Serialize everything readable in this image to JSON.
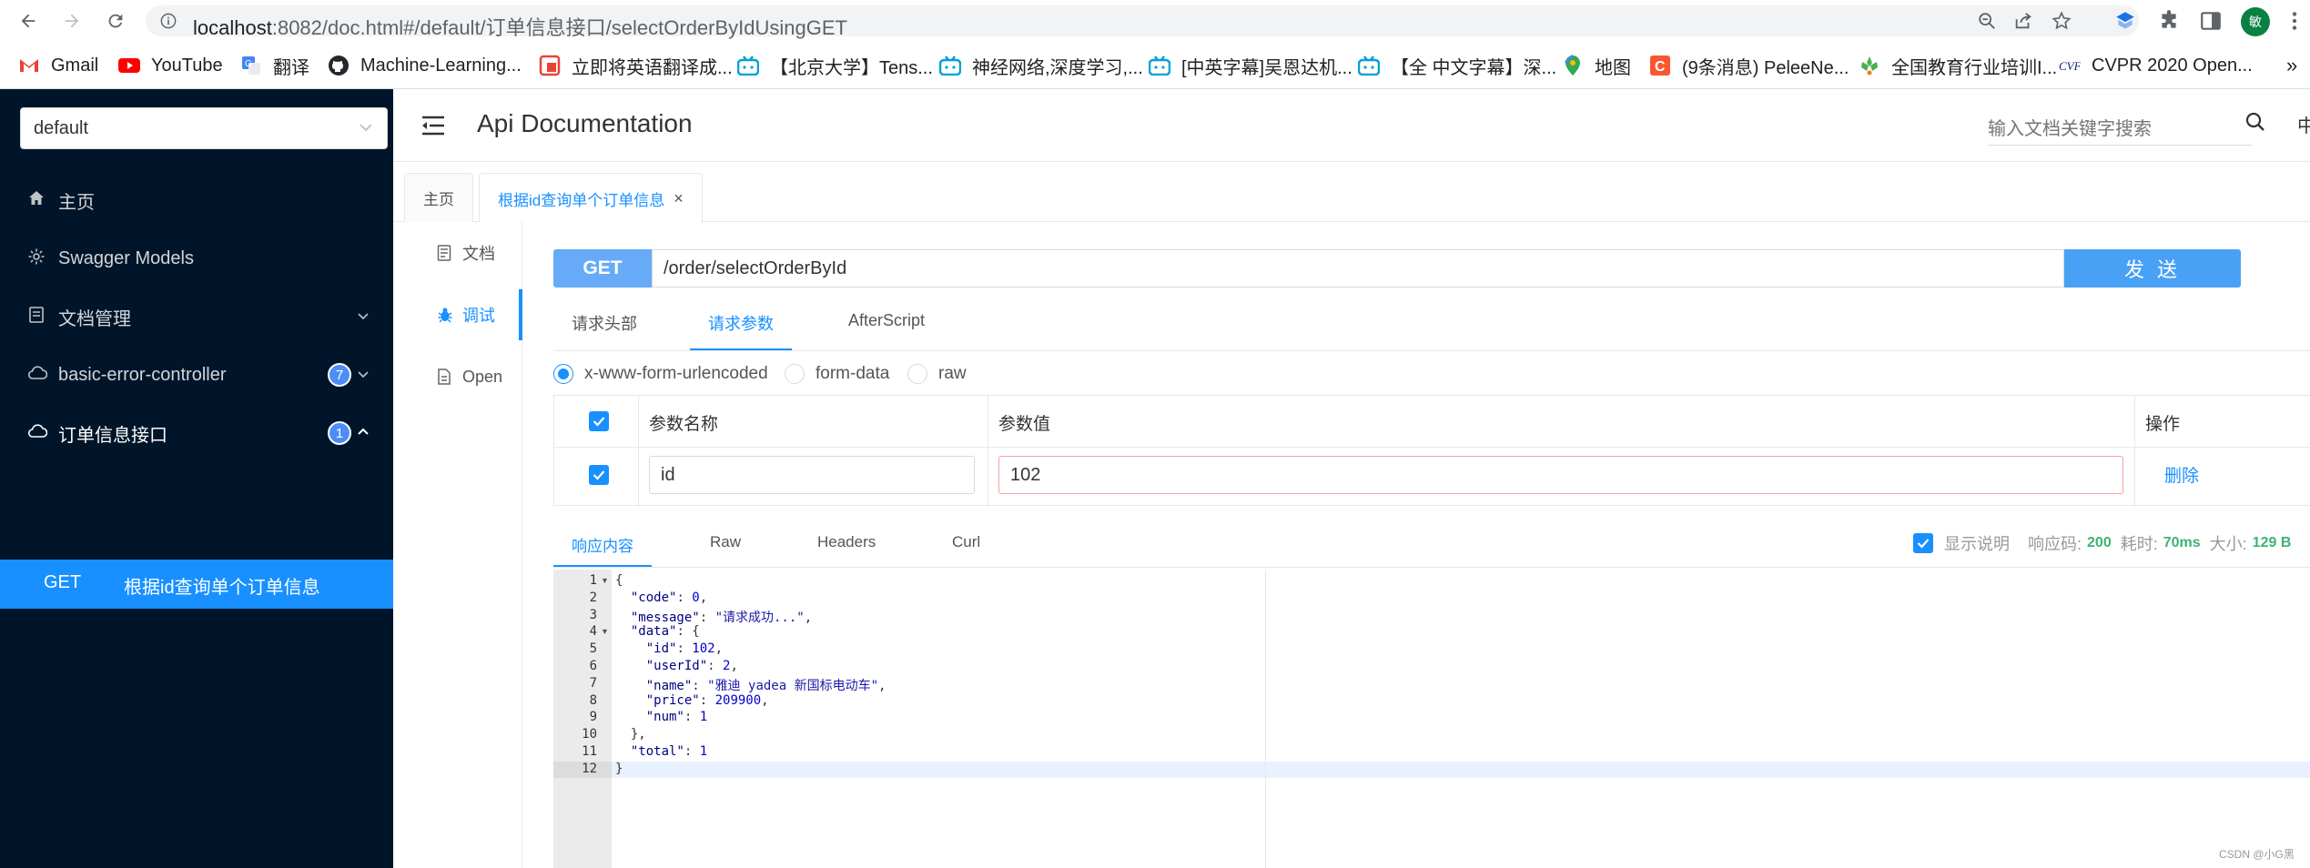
{
  "browser": {
    "url_host": "localhost",
    "url_rest": ":8082/doc.html#/default/订单信息接口/selectOrderByIdUsingGET",
    "profile_initial": "敏",
    "bookmarks": [
      {
        "label": "Gmail",
        "icon": "gmail-icon"
      },
      {
        "label": "YouTube",
        "icon": "youtube-icon"
      },
      {
        "label": "翻译",
        "icon": "translate-icon"
      },
      {
        "label": "Machine-Learning...",
        "icon": "github-icon"
      },
      {
        "label": "立即将英语翻译成...",
        "icon": "translate-app-icon"
      },
      {
        "label": "【北京大学】Tens...",
        "icon": "bilibili-icon"
      },
      {
        "label": "神经网络,深度学习,...",
        "icon": "bilibili-icon"
      },
      {
        "label": "[中英字幕]吴恩达机...",
        "icon": "bilibili-icon"
      },
      {
        "label": "【全 中文字幕】深...",
        "icon": "bilibili-icon"
      },
      {
        "label": "地图",
        "icon": "maps-icon"
      },
      {
        "label": "(9条消息) PeleeNe...",
        "icon": "csdn-icon"
      },
      {
        "label": "全国教育行业培训I...",
        "icon": "education-icon"
      },
      {
        "label": "CVPR 2020 Open...",
        "icon": "cvf-icon"
      }
    ],
    "bookmarks_overflow": "»"
  },
  "sidebar": {
    "group_select": "default",
    "items": [
      {
        "label": "主页",
        "icon": "home-icon"
      },
      {
        "label": "Swagger Models",
        "icon": "gear-icon"
      },
      {
        "label": "文档管理",
        "icon": "book-icon"
      },
      {
        "label": "basic-error-controller",
        "icon": "cloud-icon",
        "badge": "7"
      },
      {
        "label": "订单信息接口",
        "icon": "cloud-icon",
        "badge": "1"
      }
    ],
    "active_item": {
      "method": "GET",
      "label": "根据id查询单个订单信息"
    }
  },
  "header": {
    "title": "Api Documentation",
    "search_placeholder": "输入文档关键字搜索",
    "lang": "中"
  },
  "tabs": [
    {
      "label": "主页"
    },
    {
      "label": "根据id查询单个订单信息",
      "close": "×"
    }
  ],
  "sub_nav": [
    {
      "label": "文档",
      "icon": "document-icon"
    },
    {
      "label": "调试",
      "icon": "bug-icon"
    },
    {
      "label": "Open",
      "icon": "file-icon"
    }
  ],
  "request": {
    "method": "GET",
    "url": "/order/selectOrderById",
    "send_label": "发 送",
    "tabs": [
      "请求头部",
      "请求参数",
      "AfterScript"
    ],
    "active_tab": "请求参数",
    "content_types": [
      "x-www-form-urlencoded",
      "form-data",
      "raw"
    ],
    "selected_content_type": "x-www-form-urlencoded",
    "param_headers": [
      "参数名称",
      "参数值",
      "操作"
    ],
    "params": [
      {
        "name": "id",
        "value": "102",
        "action": "删除"
      }
    ]
  },
  "response": {
    "tabs": [
      "响应内容",
      "Raw",
      "Headers",
      "Curl"
    ],
    "show_desc_label": "显示说明",
    "code_label": "响应码:",
    "code": "200",
    "time_label": "耗时:",
    "time": "70ms",
    "size_label": "大小:",
    "size": "129 B",
    "body_lines": [
      "{",
      "  \"code\": 0,",
      "  \"message\": \"请求成功...\",",
      "  \"data\": {",
      "    \"id\": 102,",
      "    \"userId\": 2,",
      "    \"name\": \"雅迪 yadea 新国标电动车\",",
      "    \"price\": 209900,",
      "    \"num\": 1",
      "  },",
      "  \"total\": 1",
      "}"
    ]
  },
  "watermark": "CSDN @小G黑",
  "colors": {
    "sidebar_bg": "#001529",
    "accent": "#1890ff",
    "method_badge": "#66aaf8",
    "send_button": "#49a1f5"
  }
}
